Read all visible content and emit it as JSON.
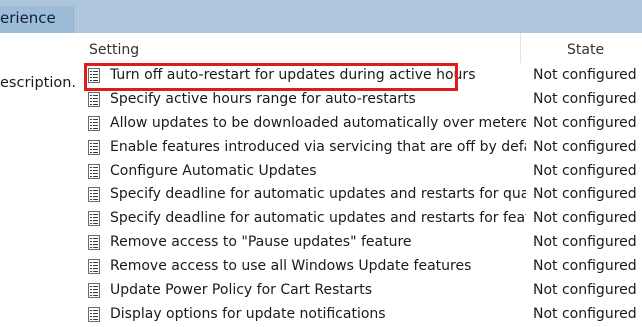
{
  "tab": {
    "label": "erience"
  },
  "left_pane": {
    "description_label": "escription."
  },
  "list": {
    "columns": {
      "setting": "Setting",
      "state": "State"
    },
    "rows": [
      {
        "setting": "Turn off auto-restart for updates during active hours",
        "state": "Not configured",
        "highlighted": true
      },
      {
        "setting": "Specify active hours range for auto-restarts",
        "state": "Not configured"
      },
      {
        "setting": "Allow updates to be downloaded automatically over metered...",
        "state": "Not configured"
      },
      {
        "setting": "Enable features introduced via servicing that are off by default",
        "state": "Not configured"
      },
      {
        "setting": "Configure Automatic Updates",
        "state": "Not configured"
      },
      {
        "setting": "Specify deadline for automatic updates and restarts for qualit...",
        "state": "Not configured"
      },
      {
        "setting": "Specify deadline for automatic updates and restarts for featu...",
        "state": "Not configured"
      },
      {
        "setting": "Remove access to \"Pause updates\" feature",
        "state": "Not configured"
      },
      {
        "setting": "Remove access to use all Windows Update features",
        "state": "Not configured"
      },
      {
        "setting": "Update Power Policy for Cart Restarts",
        "state": "Not configured"
      },
      {
        "setting": "Display options for update notifications",
        "state": "Not configured"
      }
    ]
  },
  "annotation": {
    "highlight_color": "#e01b1b"
  },
  "icons": {
    "row_icon": "policy-setting-icon"
  }
}
